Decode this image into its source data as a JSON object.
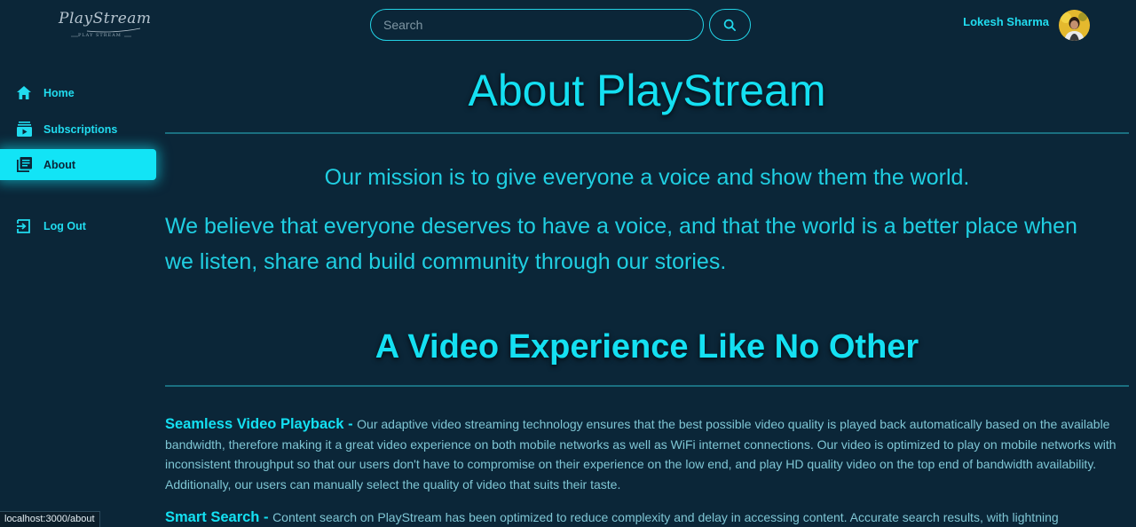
{
  "header": {
    "logo": {
      "script_text": "PlayStream",
      "tagline": "PLAY STREAM"
    },
    "search": {
      "placeholder": "Search",
      "value": ""
    },
    "user": {
      "name": "Lokesh Sharma"
    }
  },
  "sidebar": {
    "items": [
      {
        "label": "Home",
        "icon": "home-icon",
        "active": false
      },
      {
        "label": "Subscriptions",
        "icon": "subscriptions-icon",
        "active": false
      },
      {
        "label": "About",
        "icon": "about-icon",
        "active": true
      },
      {
        "label": "Log Out",
        "icon": "logout-icon",
        "active": false
      }
    ]
  },
  "main": {
    "title": "About PlayStream",
    "mission": "Our mission is to give everyone a voice and show them the world.",
    "belief": "We believe that everyone deserves to have a voice, and that the world is a better place when we listen, share and build community through our stories.",
    "subtitle": "A Video Experience Like No Other",
    "features": [
      {
        "title": "Seamless Video Playback",
        "text": "Our adaptive video streaming technology ensures that the best possible video quality is played back automatically based on the available bandwidth, therefore making it a great video experience on both mobile networks as well as WiFi internet connections. Our video is optimized to play on mobile networks with inconsistent throughput so that our users don't have to compromise on their experience on the low end, and play HD quality video on the top end of bandwidth availability. Additionally, our users can manually select the quality of video that suits their taste."
      },
      {
        "title": "Smart Search",
        "text": "Content search on PlayStream has been optimized to reduce complexity and delay in accessing content. Accurate search results, with lightning"
      }
    ]
  },
  "status_bar": {
    "url": "localhost:3000/about"
  },
  "colors": {
    "background": "#0b2638",
    "accent": "#14e0f2",
    "body_text": "#7fc6d4",
    "divider": "#1a6f80"
  }
}
